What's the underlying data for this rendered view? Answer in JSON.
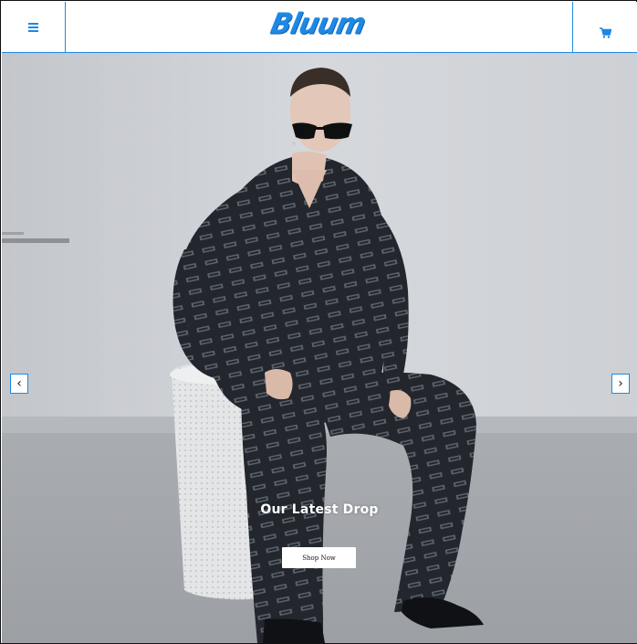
{
  "header": {
    "brand": "Bluum",
    "menu_icon": "hamburger-menu-icon",
    "cart_icon": "shopping-cart-icon",
    "accent_color": "#1e88e5"
  },
  "hero": {
    "title": "Our Latest Drop",
    "cta_label": "Shop Now",
    "prev_label": "‹",
    "next_label": "›",
    "image": "Model in black monogram pajama set and sunglasses seated on a white perforated stool against a grey wall"
  }
}
